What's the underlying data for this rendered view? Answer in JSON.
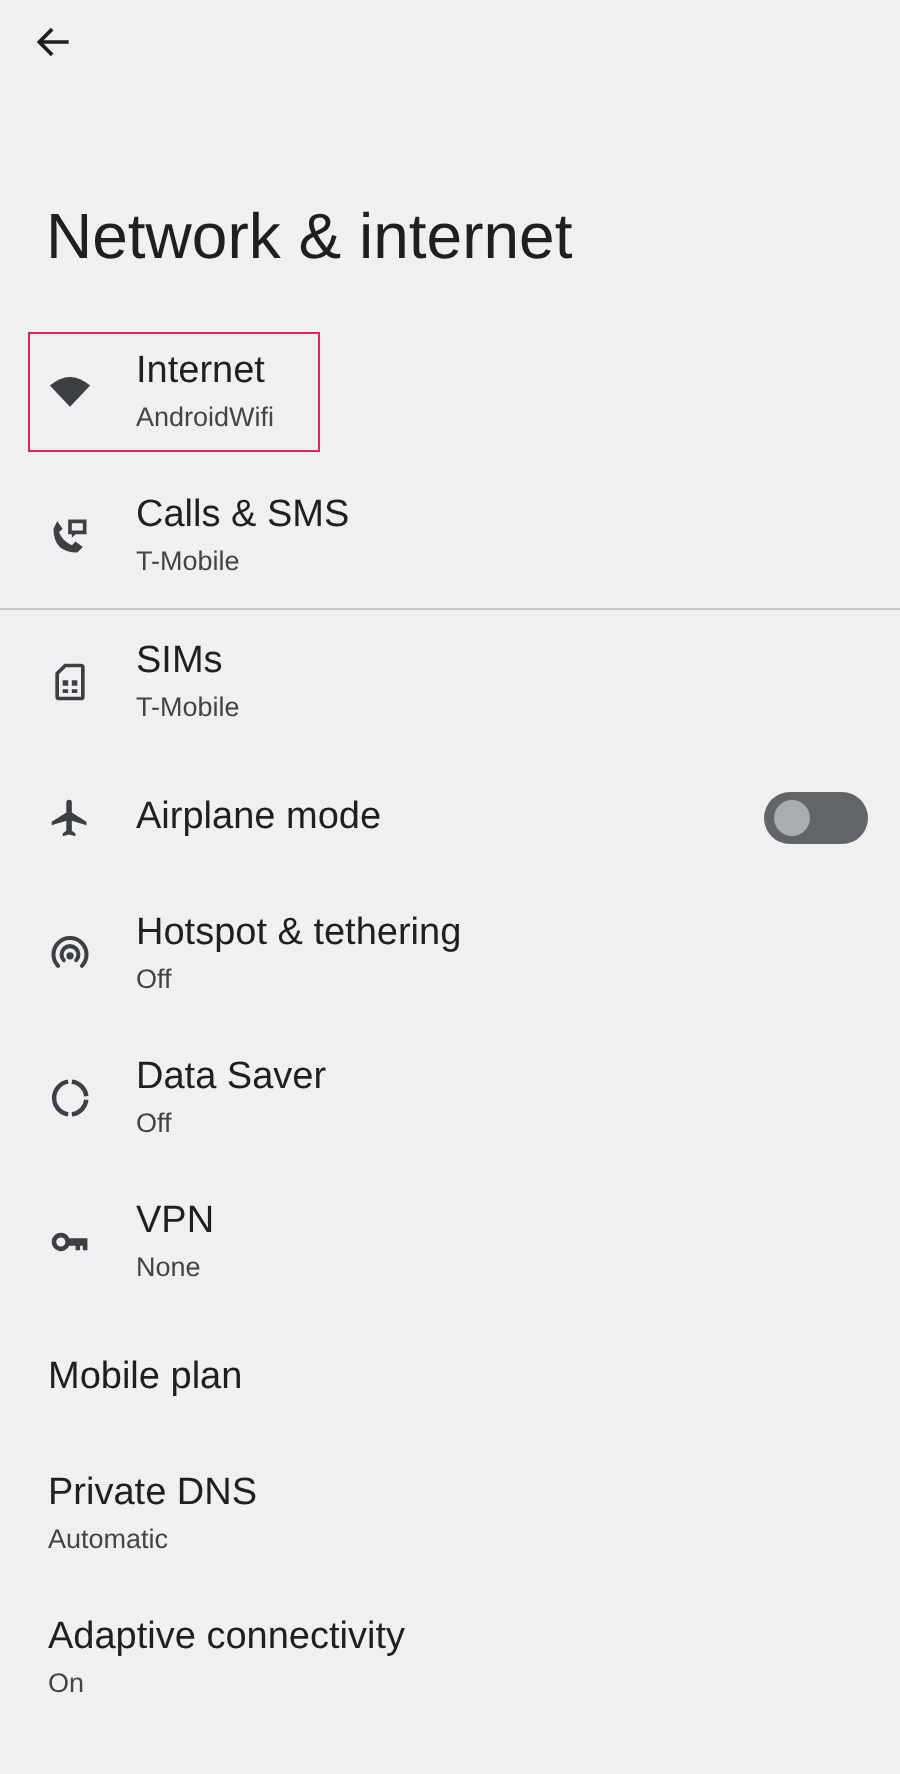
{
  "title": "Network & internet",
  "sections": [
    {
      "items": [
        {
          "kind": "icon",
          "title": "Internet",
          "subtitle": "AndroidWifi",
          "highlighted": true
        },
        {
          "kind": "icon",
          "title": "Calls & SMS",
          "subtitle": "T-Mobile",
          "highlighted": false
        }
      ]
    },
    {
      "items": [
        {
          "kind": "icon",
          "title": "SIMs",
          "subtitle": "T-Mobile",
          "highlighted": false
        },
        {
          "kind": "toggle",
          "title": "Airplane mode",
          "on": false,
          "highlighted": false
        },
        {
          "kind": "icon",
          "title": "Hotspot & tethering",
          "subtitle": "Off",
          "highlighted": false
        },
        {
          "kind": "icon",
          "title": "Data Saver",
          "subtitle": "Off",
          "highlighted": false
        },
        {
          "kind": "icon",
          "title": "VPN",
          "subtitle": "None",
          "highlighted": false
        },
        {
          "kind": "plain",
          "title": "Mobile plan",
          "highlighted": false
        },
        {
          "kind": "plain",
          "title": "Private DNS",
          "subtitle": "Automatic",
          "highlighted": false
        },
        {
          "kind": "plain",
          "title": "Adaptive connectivity",
          "subtitle": "On",
          "highlighted": false
        }
      ]
    }
  ]
}
